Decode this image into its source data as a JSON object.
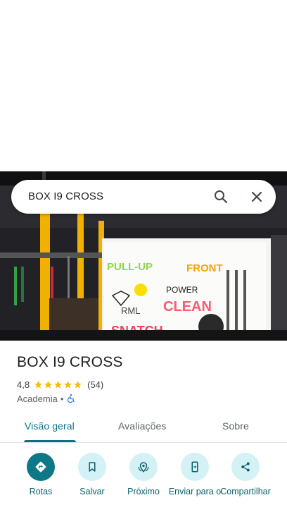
{
  "search": {
    "query": "BOX I9 CROSS"
  },
  "place": {
    "title": "BOX I9 CROSS",
    "rating": "4,8",
    "review_count": "(54)",
    "category": "Academia",
    "separator": "•"
  },
  "tabs": [
    {
      "label": "Visão geral",
      "active": true
    },
    {
      "label": "Avaliações",
      "active": false
    },
    {
      "label": "Sobre",
      "active": false
    }
  ],
  "actions": [
    {
      "label": "Rotas",
      "icon": "directions-icon"
    },
    {
      "label": "Salvar",
      "icon": "bookmark-icon"
    },
    {
      "label": "Próximo",
      "icon": "nearby-icon"
    },
    {
      "label": "Enviar para o",
      "icon": "send-to-phone-icon"
    },
    {
      "label": "Compartilhar",
      "icon": "share-icon"
    }
  ],
  "colors": {
    "accent": "#0b7285",
    "primary_button": "#0d7986",
    "action_circle": "#d4f1f6",
    "star": "#fbbc04",
    "accessibility": "#1a73e8"
  }
}
